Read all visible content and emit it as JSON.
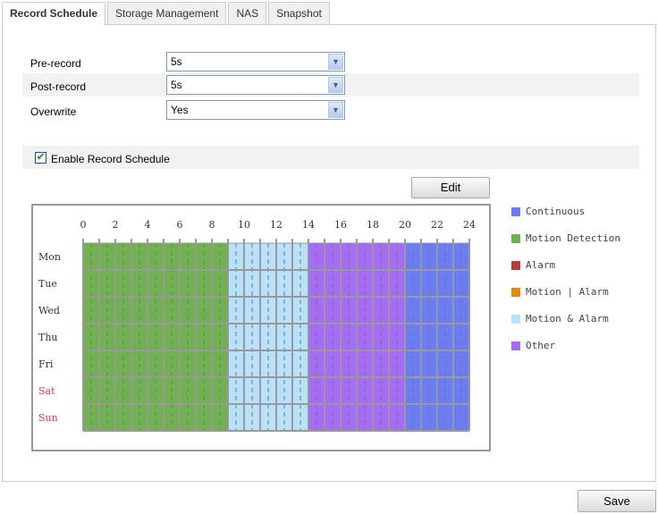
{
  "tabs": [
    {
      "label": "Record Schedule",
      "active": true
    },
    {
      "label": "Storage Management"
    },
    {
      "label": "NAS"
    },
    {
      "label": "Snapshot"
    }
  ],
  "settings": {
    "pre_record": {
      "label": "Pre-record",
      "value": "5s"
    },
    "post_record": {
      "label": "Post-record",
      "value": "5s"
    },
    "overwrite": {
      "label": "Overwrite",
      "value": "Yes"
    }
  },
  "enable_schedule": {
    "label": "Enable Record Schedule",
    "checked": true
  },
  "edit_label": "Edit",
  "save_label": "Save",
  "schedule": {
    "hour_labels": [
      "0",
      "2",
      "4",
      "6",
      "8",
      "10",
      "12",
      "14",
      "16",
      "18",
      "20",
      "22",
      "24"
    ],
    "days": [
      {
        "label": "Mon",
        "weekend": false
      },
      {
        "label": "Tue",
        "weekend": false
      },
      {
        "label": "Wed",
        "weekend": false
      },
      {
        "label": "Thu",
        "weekend": false
      },
      {
        "label": "Fri",
        "weekend": false
      },
      {
        "label": "Sat",
        "weekend": true
      },
      {
        "label": "Sun",
        "weekend": true
      }
    ],
    "segments_every_day": [
      {
        "start": 0,
        "end": 9,
        "type": "Motion Detection"
      },
      {
        "start": 9,
        "end": 14,
        "type": "Motion & Alarm"
      },
      {
        "start": 14,
        "end": 20,
        "type": "Other"
      },
      {
        "start": 20,
        "end": 24,
        "type": "Continuous"
      }
    ],
    "weekend_color": "#ff3333"
  },
  "legend": [
    {
      "label": "Continuous",
      "color": "#6a7cf6"
    },
    {
      "label": "Motion Detection",
      "color": "#6fb24f"
    },
    {
      "label": "Alarm",
      "color": "#b93c3c"
    },
    {
      "label": "Motion | Alarm",
      "color": "#e8890a"
    },
    {
      "label": "Motion & Alarm",
      "color": "#b8e1fb"
    },
    {
      "label": "Other",
      "color": "#a66cf7"
    }
  ]
}
